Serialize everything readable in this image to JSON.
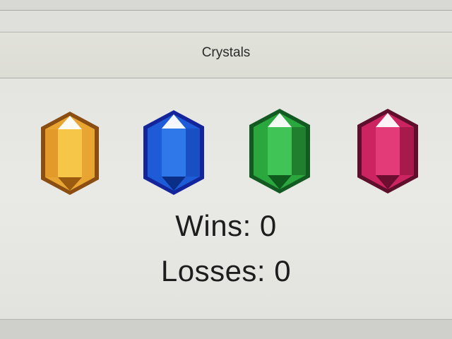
{
  "header": {
    "title": "Crystals"
  },
  "crystals": [
    {
      "color_name": "yellow",
      "fill": "#e9a531",
      "light": "#f6c649",
      "dark": "#9a5a10",
      "outline": "#8a4d12"
    },
    {
      "color_name": "blue",
      "fill": "#1e5bd6",
      "light": "#2f78ea",
      "dark": "#0b2e86",
      "outline": "#14249b"
    },
    {
      "color_name": "green",
      "fill": "#2aa83e",
      "light": "#3fc455",
      "dark": "#0f5a1d",
      "outline": "#135a22"
    },
    {
      "color_name": "pink",
      "fill": "#cc2460",
      "light": "#e33a78",
      "dark": "#6d0d30",
      "outline": "#5d0f2c"
    }
  ],
  "scores": {
    "wins_label": "Wins: 0",
    "losses_label": "Losses: 0"
  }
}
